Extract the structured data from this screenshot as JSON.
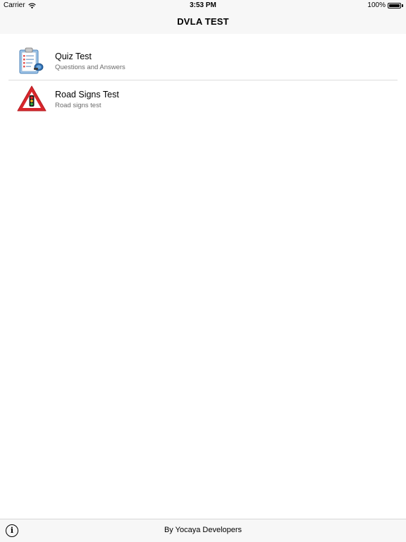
{
  "status_bar": {
    "carrier": "Carrier",
    "time": "3:53 PM",
    "battery": "100%",
    "battery_level": 1.0
  },
  "nav": {
    "title": "DVLA TEST"
  },
  "list": {
    "items": [
      {
        "title": "Quiz Test",
        "subtitle": "Questions and Answers",
        "icon": "clipboard-quiz-icon"
      },
      {
        "title": "Road Signs Test",
        "subtitle": "Road signs test",
        "icon": "traffic-light-warning-sign-icon"
      }
    ]
  },
  "toolbar": {
    "info_label": "i",
    "footer": "By Yocaya Developers"
  },
  "colors": {
    "bar_background": "#f7f7f7",
    "separator": "#dcdcdc",
    "subtitle_text": "#6b6b6b",
    "sign_red": "#d8262c"
  }
}
